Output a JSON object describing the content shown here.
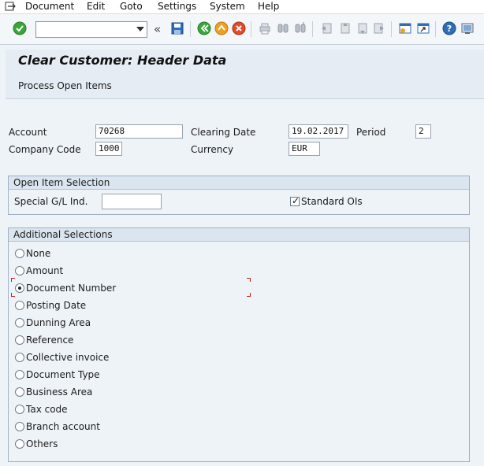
{
  "menu": {
    "items": [
      "Document",
      "Edit",
      "Goto",
      "Settings",
      "System",
      "Help"
    ]
  },
  "toolbar": {
    "command_value": "",
    "icons": [
      "enter-icon",
      "save-icon",
      "back-icon",
      "exit-icon",
      "cancel-icon",
      "print-icon",
      "find-icon",
      "find-next-icon",
      "first-page-icon",
      "previous-page-icon",
      "next-page-icon",
      "last-page-icon",
      "create-session-icon",
      "shortcut-icon",
      "help-icon",
      "customize-layout-icon"
    ]
  },
  "title": "Clear Customer: Header Data",
  "app_toolbar": {
    "process_open_items": "Process Open Items"
  },
  "header": {
    "account_label": "Account",
    "account_value": "70268",
    "clearing_date_label": "Clearing Date",
    "clearing_date_value": "19.02.2017",
    "period_label": "Period",
    "period_value": "2",
    "company_code_label": "Company Code",
    "company_code_value": "1000",
    "currency_label": "Currency",
    "currency_value": "EUR"
  },
  "open_item_selection": {
    "title": "Open Item Selection",
    "special_gl_label": "Special G/L Ind.",
    "special_gl_value": "",
    "standard_ois_label": "Standard OIs",
    "standard_ois_checked": true
  },
  "additional_selections": {
    "title": "Additional Selections",
    "options": [
      "None",
      "Amount",
      "Document Number",
      "Posting Date",
      "Dunning Area",
      "Reference",
      "Collective invoice",
      "Document Type",
      "Business Area",
      "Tax code",
      "Branch account",
      "Others"
    ],
    "selected": "Document Number"
  },
  "colors": {
    "background": "#eef3f8",
    "group_header": "#dbe5ef",
    "focus_marker": "#d01b1b"
  }
}
